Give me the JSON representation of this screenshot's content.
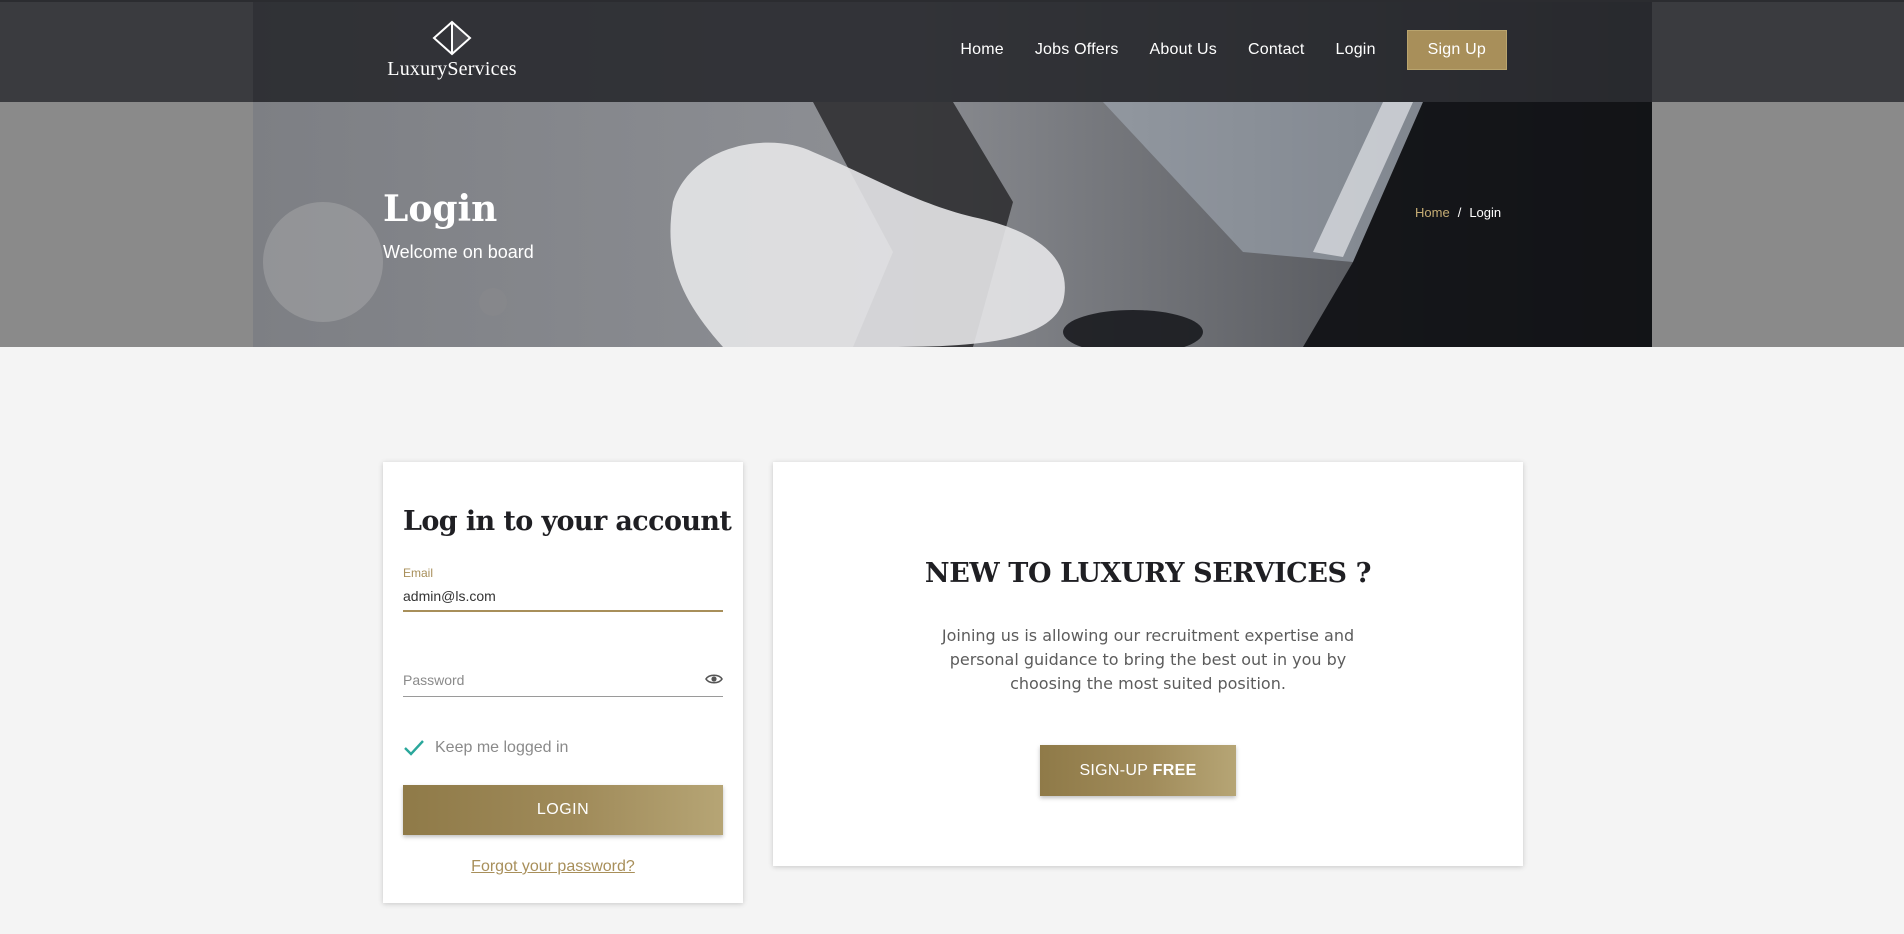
{
  "brand": {
    "name": "LuxuryServices",
    "logo_icon": "diamond-icon"
  },
  "nav": {
    "items": [
      "Home",
      "Jobs Offers",
      "About Us",
      "Contact",
      "Login"
    ],
    "signup_label": "Sign Up"
  },
  "hero": {
    "title": "Login",
    "subtitle": "Welcome on board",
    "breadcrumb": {
      "home": "Home",
      "separator": "/",
      "current": "Login"
    }
  },
  "login": {
    "title": "Log in to your account",
    "email_label": "Email",
    "email_value": "admin@ls.com",
    "password_placeholder": "Password",
    "keep_logged_in": "Keep me logged in",
    "keep_checked": true,
    "button": "LOGIN",
    "forgot": "Forgot your password?"
  },
  "signup": {
    "title": "NEW TO LUXURY SERVICES ?",
    "description": "Joining us is allowing our recruitment expertise and personal guidance to bring the best out in you by choosing the most suited position.",
    "button_prefix": "SIGN-UP",
    "button_bold": "FREE"
  },
  "colors": {
    "accent": "#a88f5a",
    "nav_bg": "#2b2c30",
    "page_bg": "#f4f4f4",
    "check": "#2aa79b"
  }
}
